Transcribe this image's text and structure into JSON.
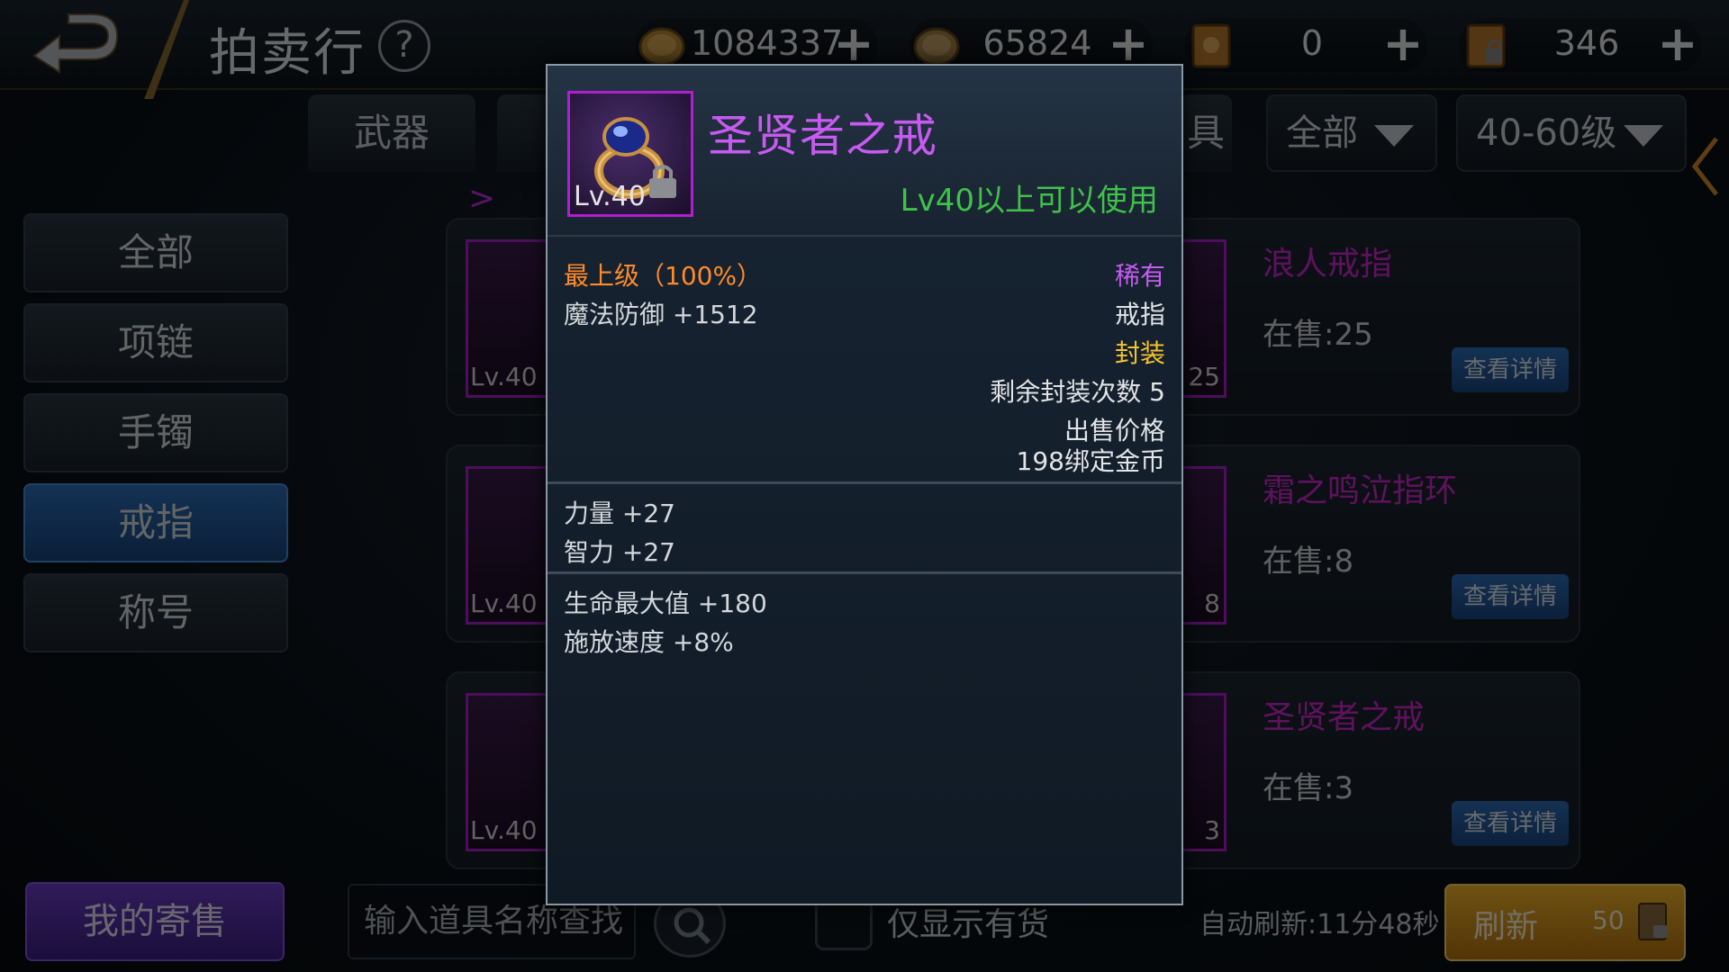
{
  "header": {
    "title": "拍卖行",
    "help": "?",
    "currencies": [
      {
        "icon": "gold-coin-icon",
        "value": "1084337",
        "plus": "+"
      },
      {
        "icon": "bound-gold-coin-icon",
        "value": "65824",
        "plus": "+"
      },
      {
        "icon": "scroll-icon",
        "value": "0",
        "plus": "+"
      },
      {
        "icon": "locked-scroll-icon",
        "value": "346",
        "plus": "+"
      }
    ]
  },
  "tabs": {
    "weapon": "武器",
    "partial_right": "具"
  },
  "filters": {
    "type": "全部",
    "level": "40-60级"
  },
  "sidebar": {
    "items": [
      {
        "label": "全部"
      },
      {
        "label": "项链"
      },
      {
        "label": "手镯"
      },
      {
        "label": "戒指"
      },
      {
        "label": "称号"
      }
    ]
  },
  "breadcrumb_arrow": ">",
  "list": {
    "items": [
      {
        "name": "浪人戒指",
        "stock": "在售:25",
        "level": "Lv.40",
        "count": "25",
        "detail": "查看详情"
      },
      {
        "name": "霜之鸣泣指环",
        "stock": "在售:8",
        "level": "Lv.40",
        "count": "8",
        "detail": "查看详情"
      },
      {
        "name": "圣贤者之戒",
        "stock": "在售:3",
        "level": "Lv.40",
        "count": "3",
        "detail": "查看详情"
      }
    ]
  },
  "bottom": {
    "my_consign": "我的寄售",
    "search_placeholder": "输入道具名称查找",
    "stock_only": "仅显示有货",
    "auto_refresh": "自动刷新:11分48秒",
    "refresh": "刷新",
    "refresh_cost": "50"
  },
  "popup": {
    "item_name": "圣贤者之戒",
    "level": "Lv.40",
    "requirement": "Lv40以上可以使用",
    "quality": "最上级（100%）",
    "rarity": "稀有",
    "main_stat": "魔法防御 +1512",
    "slot_type": "戒指",
    "sealed": "封装",
    "seal_count": "剩余封装次数 5",
    "price_label": "出售价格",
    "price_value": "198绑定金币",
    "stats": [
      "力量 +27",
      "智力 +27"
    ],
    "bonus_stats": [
      "生命最大值 +180",
      "施放速度 +8%"
    ]
  },
  "colors": {
    "quality": "#ff8a2a",
    "rarity": "#c75af0",
    "sealed": "#f5c330",
    "requirement": "#3fc24a",
    "active_tab": "#2d6fb8"
  }
}
